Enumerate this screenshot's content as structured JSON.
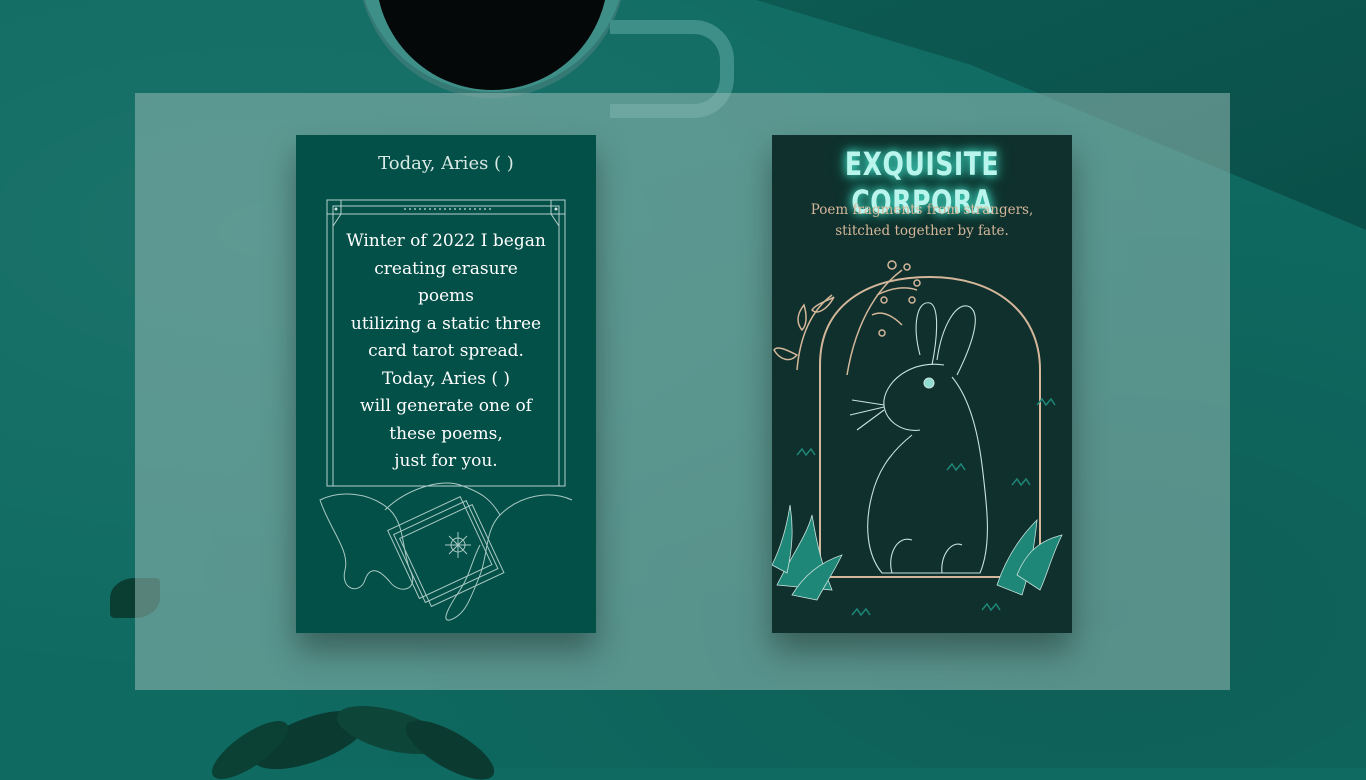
{
  "left_card": {
    "title": "Today, Aries (        )",
    "body_lines": [
      "Winter of 2022 I began",
      "creating erasure",
      "poems",
      "utilizing a static three",
      "card tarot spread.",
      "Today, Aries (        )",
      "will generate one of",
      "these poems,",
      "just for you."
    ]
  },
  "right_card": {
    "title": "EXQUISITE CORPORA",
    "subtitle_lines": [
      "Poem fragments from strangers,",
      "stitched together by fate."
    ]
  },
  "colors": {
    "background": "#0f6b62",
    "left_card": "#035048",
    "right_card": "#0f302c",
    "accent_gold": "#d4b79a",
    "title_glow": "#45e0c8"
  },
  "icons": [
    "coffee-cup-icon",
    "notebook-icon",
    "plant-icon",
    "hands-cards-icon",
    "rabbit-icon",
    "arch-icon",
    "grass-icon",
    "branch-icon"
  ]
}
